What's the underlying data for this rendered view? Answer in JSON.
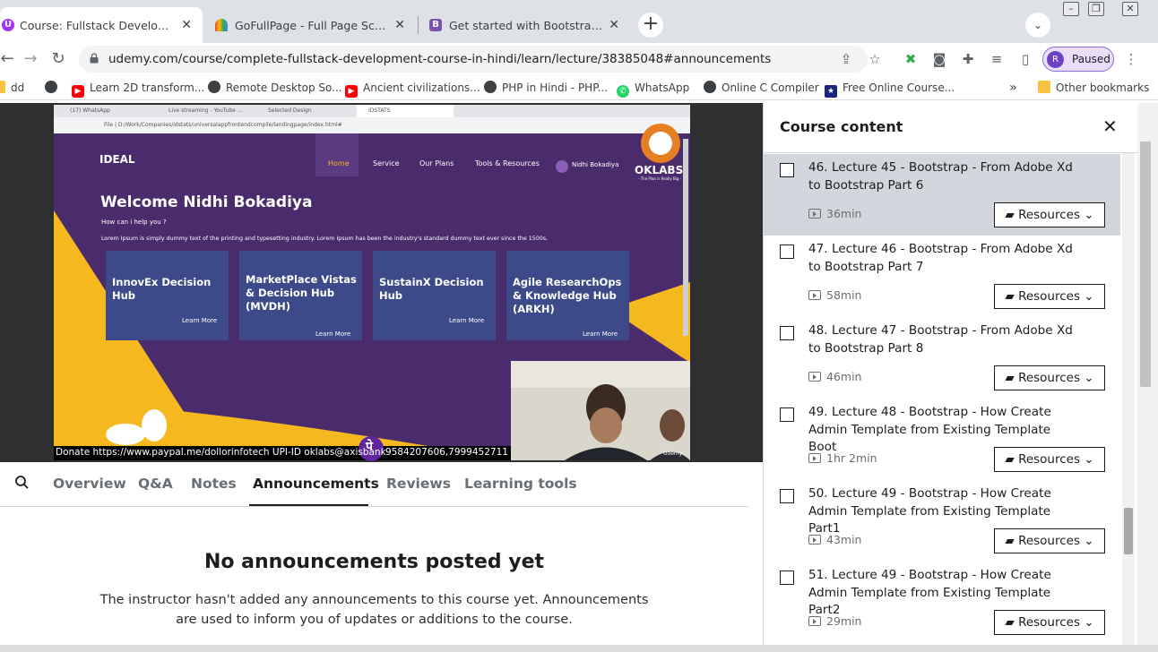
{
  "browser": {
    "tabs": [
      {
        "title": "Course: Fullstack Development C",
        "favicon": "udemy-icon",
        "color": "#a435f0",
        "active": true
      },
      {
        "title": "GoFullPage - Full Page Screen Ca",
        "favicon": "gofullpage-icon",
        "color": "#ea4335",
        "active": false
      },
      {
        "title": "Get started with Bootstrap · Boot",
        "favicon": "bootstrap-icon",
        "color": "#7952b3",
        "active": false
      }
    ],
    "url": "udemy.com/course/complete-fullstack-development-course-in-hindi/learn/lecture/38385048#announcements",
    "profile": {
      "initial": "R",
      "label": "Paused"
    },
    "bookmarks": [
      {
        "label": "dd",
        "icon": "folder-icon"
      },
      {
        "label": "Learn 2D transform...",
        "icon": "youtube-icon"
      },
      {
        "label": "Remote Desktop So...",
        "icon": "globe-icon"
      },
      {
        "label": "Ancient civilizations...",
        "icon": "youtube-icon"
      },
      {
        "label": "PHP in Hindi - PHP...",
        "icon": "globe-icon"
      },
      {
        "label": "WhatsApp",
        "icon": "whatsapp-icon"
      },
      {
        "label": "Online C Compiler",
        "icon": "globe-icon"
      },
      {
        "label": "Free Online Course...",
        "icon": "courses-icon"
      }
    ],
    "bookmarks_overflow": "»",
    "other_bookmarks": "Other bookmarks"
  },
  "video": {
    "inner_tabs": [
      "(17) WhatsApp",
      "Live streaming - YouTube Studio",
      "Selected Design",
      "IDSTATS"
    ],
    "inner_url": "File | D:/Work/Companies/idstats/universalappfrontendcompile/landingpage/index.html#",
    "logo": "IDEAL",
    "nav": [
      "Home",
      "Service",
      "Our Plans",
      "Tools & Resources"
    ],
    "user": "Nidhi Bokadiya",
    "welcome": "Welcome Nidhi Bokadiya",
    "subtitle": "How can i help you ?",
    "lorem": "Lorem Ipsum is simply dummy text of the printing and typesetting industry. Lorem Ipsum has been the industry's standard dummy text ever since the 1500s,",
    "cards": [
      {
        "title": "InnovEx Decision Hub",
        "link": "Learn More"
      },
      {
        "title": "MarketPlace Vistas & Decision Hub (MVDH)",
        "link": "Learn More"
      },
      {
        "title": "SustainX Decision Hub",
        "link": "Learn More"
      },
      {
        "title": "Agile ResearchOps & Knowledge Hub (ARKH)",
        "link": "Learn More"
      }
    ],
    "brand": "OKLABS",
    "brand_tagline": "- The Plan is Really Big -",
    "webcam_watermark": "Udemy",
    "donate_left": "Donate https://www.paypal.me/dollorinfotech UPI-ID oklabs@axisbank",
    "donate_right": "9584207606,7999452711"
  },
  "lecture_tabs": {
    "items": [
      "Overview",
      "Q&A",
      "Notes",
      "Announcements",
      "Reviews",
      "Learning tools"
    ],
    "active": "Announcements"
  },
  "announcements": {
    "title": "No announcements posted yet",
    "description": "The instructor hasn't added any announcements to this course yet. Announcements are used to inform you of updates or additions to the course."
  },
  "sidebar": {
    "title": "Course content",
    "resources_label": "Resources",
    "lectures": [
      {
        "title": "46. Lecture 45 - Bootstrap - From Adobe Xd to Bootstrap Part 6",
        "duration": "36min",
        "current": true
      },
      {
        "title": "47. Lecture 46 - Bootstrap - From Adobe Xd to Bootstrap Part 7",
        "duration": "58min",
        "current": false
      },
      {
        "title": "48. Lecture 47 - Bootstrap - From Adobe Xd to Bootstrap Part 8",
        "duration": "46min",
        "current": false
      },
      {
        "title": "49. Lecture 48 - Bootstrap - How Create Admin Template from Existing Template Boot",
        "duration": "1hr 2min",
        "current": false
      },
      {
        "title": "50. Lecture 49 - Bootstrap - How Create Admin Template from Existing Template Part1",
        "duration": "43min",
        "current": false
      },
      {
        "title": "51. Lecture 49 - Bootstrap - How Create Admin Template from Existing Template Part2",
        "duration": "29min",
        "current": false
      }
    ]
  }
}
